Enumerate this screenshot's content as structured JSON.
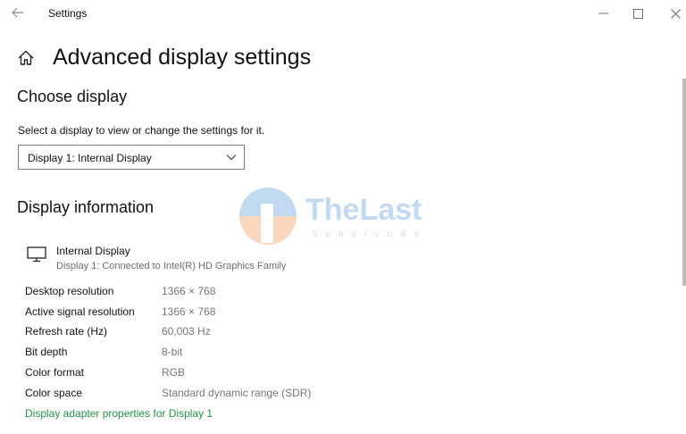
{
  "window": {
    "title": "Settings"
  },
  "page": {
    "title": "Advanced display settings"
  },
  "choose_display": {
    "heading": "Choose display",
    "instruction": "Select a display to view or change the settings for it.",
    "selected_display": "Display 1: Internal Display"
  },
  "display_information": {
    "heading": "Display information",
    "display_name": "Internal Display",
    "display_connection": "Display 1: Connected to Intel(R) HD Graphics Family",
    "rows": [
      {
        "label": "Desktop resolution",
        "value": "1366 × 768"
      },
      {
        "label": "Active signal resolution",
        "value": "1366 × 768"
      },
      {
        "label": "Refresh rate (Hz)",
        "value": "60,003 Hz"
      },
      {
        "label": "Bit depth",
        "value": "8-bit"
      },
      {
        "label": "Color format",
        "value": "RGB"
      },
      {
        "label": "Color space",
        "value": "Standard dynamic range (SDR)"
      }
    ],
    "adapter_link": "Display adapter properties for Display 1"
  },
  "watermark": {
    "brand": "TheLast",
    "tagline": "SURVIVORS"
  },
  "icons": {
    "back": "back-arrow-icon",
    "minimize": "minimize-icon",
    "maximize": "maximize-icon",
    "close": "close-icon",
    "home": "home-icon",
    "dropdown": "chevron-down-icon",
    "monitor": "monitor-icon"
  },
  "colors": {
    "link": "#1e9444",
    "secondary_text": "#767676",
    "watermark_blue": "#8fbde8",
    "watermark_orange": "#f4b887"
  }
}
